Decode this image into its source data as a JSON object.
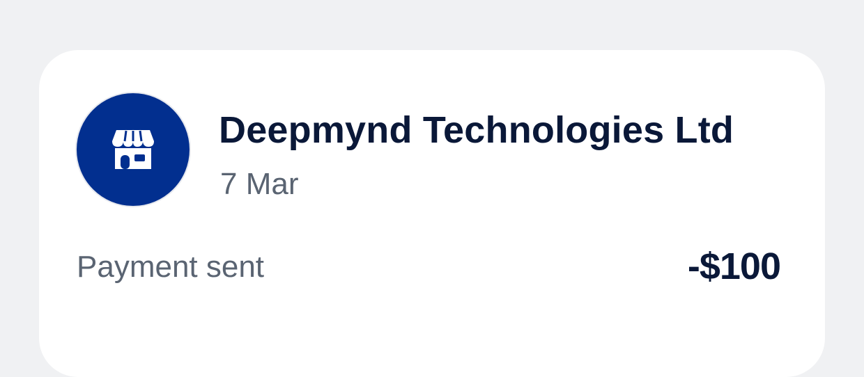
{
  "transaction": {
    "merchant_name": "Deepmynd Technologies Ltd",
    "date": "7 Mar",
    "type": "Payment sent",
    "amount": "-$100",
    "icon": "store-icon"
  },
  "colors": {
    "background": "#f0f1f3",
    "card": "#ffffff",
    "avatar": "#022f8f",
    "primary_text": "#0a1838",
    "secondary_text": "#5a6472"
  }
}
